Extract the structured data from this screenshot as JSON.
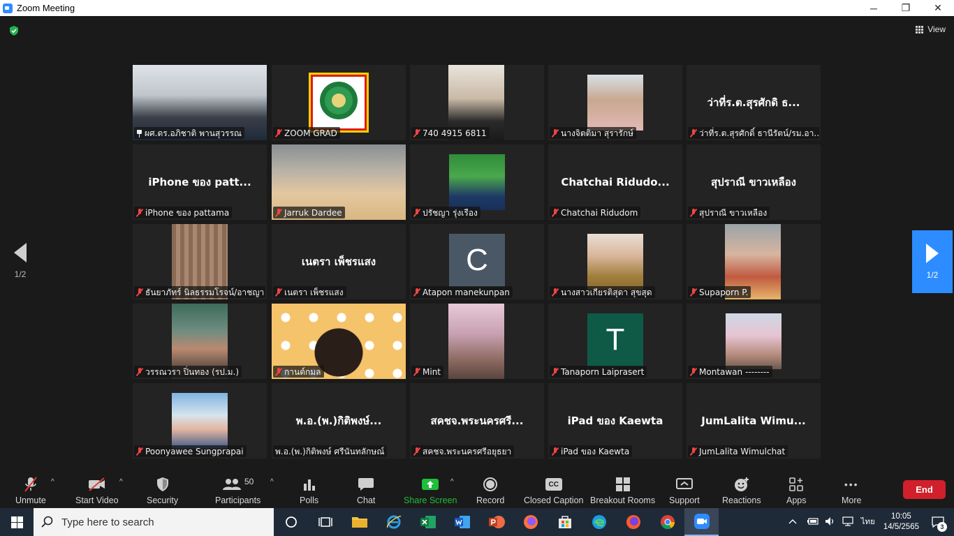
{
  "window": {
    "title": "Zoom Meeting",
    "min_glyph": "─",
    "max_glyph": "❐",
    "close_glyph": "✕"
  },
  "view_label": "View",
  "pager": {
    "left_label": "1/2",
    "right_label": "1/2"
  },
  "tiles": [
    {
      "label": "ผศ.ดร.อภิชาติ พานสุวรรณ",
      "big": "",
      "pin": true
    },
    {
      "label": "ZOOM GRAD",
      "big": ""
    },
    {
      "label": "740 4915 6811",
      "big": ""
    },
    {
      "label": "นางจิตติมา สุรารักษ์",
      "big": ""
    },
    {
      "label": "ว่าที่ร.ต.สุรศักดิ์ ธานีรัตน์/รม.อา...",
      "big": "ว่าที่ร.ต.สุรศักดิ ธ..."
    },
    {
      "label": "iPhone ของ pattama",
      "big": "iPhone ของ patt..."
    },
    {
      "label": "Jarruk Dardee",
      "big": ""
    },
    {
      "label": "ปรัชญา รุ่งเรือง",
      "big": ""
    },
    {
      "label": "Chatchai Ridudom",
      "big": "Chatchai  Ridudo..."
    },
    {
      "label": "สุปราณี ขาวเหลือง",
      "big": "สุปราณี ขาวเหลือง"
    },
    {
      "label": "ธันยาภัทร์ นิลธรรมโรจน์/อาชญา",
      "big": ""
    },
    {
      "label": "เนตรา เพ็ชรแสง",
      "big": "เนตรา เพ็ชรแสง"
    },
    {
      "label": "Atapon manekunpan",
      "big": "",
      "letter": "C"
    },
    {
      "label": "นางสาวเกียรติสุดา สุขสุด",
      "big": ""
    },
    {
      "label": "Supaporn P.",
      "big": ""
    },
    {
      "label": "วรรณวรา ปิ่นทอง (รป.ม.)",
      "big": ""
    },
    {
      "label": "กานต์กมล",
      "big": ""
    },
    {
      "label": "Mint",
      "big": ""
    },
    {
      "label": "Tanaporn Laiprasert",
      "big": "",
      "letter": "T"
    },
    {
      "label": "Montawan --------",
      "big": ""
    },
    {
      "label": "Poonyawee Sungprapai",
      "big": ""
    },
    {
      "label": "พ.อ.(พ.)กิติพงษ์ ศรีนันทลักษณ์",
      "big": "พ.อ.(พ.)กิติพงษ์..."
    },
    {
      "label": "สคชจ.พระนครศรีอยุธยา",
      "big": "สคชจ.พระนครศรี..."
    },
    {
      "label": "iPad ของ Kaewta",
      "big": "iPad ของ Kaewta"
    },
    {
      "label": "JumLalita Wimulchat",
      "big": "JumLalita  Wimu..."
    }
  ],
  "toolbar": {
    "unmute": "Unmute",
    "start_video": "Start Video",
    "security": "Security",
    "participants": "Participants",
    "participants_count": "50",
    "polls": "Polls",
    "chat": "Chat",
    "share_screen": "Share Screen",
    "record": "Record",
    "closed_caption": "Closed Caption",
    "breakout_rooms": "Breakout Rooms",
    "support": "Support",
    "reactions": "Reactions",
    "apps": "Apps",
    "more": "More",
    "end": "End",
    "cc_glyph": "CC",
    "more_glyph": "•••",
    "caret_glyph": "^"
  },
  "taskbar": {
    "search_placeholder": "Type here to search",
    "language": "ไทย",
    "time": "10:05",
    "date": "14/5/2565",
    "notifications": "3"
  },
  "colors": {
    "active_speaker": "#c9e36b",
    "accent_blue": "#2d8cff",
    "share_green": "#1fbf3a",
    "end_red": "#d11f2b",
    "avatar_c": "#4a5866",
    "avatar_t": "#0e5a47"
  }
}
